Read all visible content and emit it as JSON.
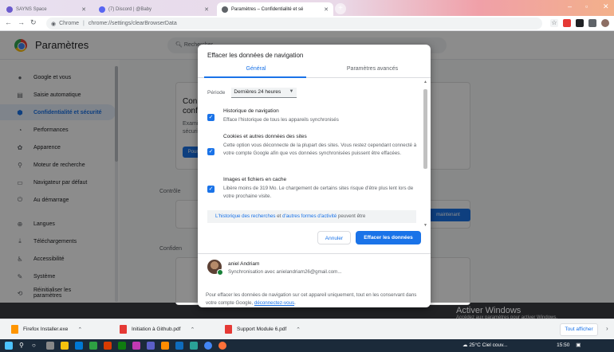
{
  "tabs": [
    {
      "label": "SAYNS Space"
    },
    {
      "label": "(7) Discord | @Baby"
    },
    {
      "label": "Paramètres – Confidentialité et sé"
    }
  ],
  "address": {
    "site": "Chrome",
    "url": "chrome://settings/clearBrowserData"
  },
  "settings": {
    "title": "Paramètres",
    "search_placeholder": "Rechercher",
    "nav": [
      {
        "label": "Google et vous",
        "icon": "person-icon"
      },
      {
        "label": "Saisie automatique",
        "icon": "clipboard-icon"
      },
      {
        "label": "Confidentialité et sécurité",
        "icon": "shield-icon"
      },
      {
        "label": "Performances",
        "icon": "speedometer-icon"
      },
      {
        "label": "Apparence",
        "icon": "palette-icon"
      },
      {
        "label": "Moteur de recherche",
        "icon": "search-icon"
      },
      {
        "label": "Navigateur par défaut",
        "icon": "browser-icon"
      },
      {
        "label": "Au démarrage",
        "icon": "power-icon"
      },
      {
        "label": "Langues",
        "icon": "globe-icon"
      },
      {
        "label": "Téléchargements",
        "icon": "download-icon"
      },
      {
        "label": "Accessibilité",
        "icon": "accessibility-icon"
      },
      {
        "label": "Système",
        "icon": "wrench-icon"
      },
      {
        "label": "Réinitialiser les paramètres",
        "icon": "reset-icon"
      }
    ],
    "bg": {
      "heading_line1": "Con",
      "heading_line2": "conf",
      "sub1": "Examin",
      "sub2": "sécurit",
      "button": "Pour",
      "section1": "Contrôle",
      "section2": "Confiden",
      "right_button": "maintenant"
    }
  },
  "dialog": {
    "title": "Effacer les données de navigation",
    "tab_basic": "Général",
    "tab_advanced": "Paramètres avancés",
    "period_label": "Période",
    "period_value": "Dernières 24 heures",
    "options": [
      {
        "title": "Historique de navigation",
        "desc": "Efface l'historique de tous les appareils synchronisés",
        "checked": true
      },
      {
        "title": "Cookies et autres données des sites",
        "desc": "Cette option vous déconnecte de la plupart des sites. Vous restez cependant connecté à votre compte Google afin que vos données synchronisées puissent être effacées.",
        "checked": true
      },
      {
        "title": "Images et fichiers en cache",
        "desc": "Libère moins de 319 Mo. Le chargement de certains sites risque d'être plus lent lors de votre prochaine visite.",
        "checked": true
      }
    ],
    "info_link1": "L'historique des recherches",
    "info_mid": " et ",
    "info_link2": "d'autres formes d'activité",
    "info_rest": " peuvent être",
    "cancel": "Annuler",
    "confirm": "Effacer les données",
    "account_name": "aniel Andriam",
    "account_sync": "Synchronisation avec anielandriam26@gmail.com...",
    "footnote": "Pour effacer les données de navigation sur cet appareil uniquement, tout en les conservant dans votre compte Google, ",
    "footnote_link": "déconnectez-vous",
    "footnote_end": "."
  },
  "downloads": [
    {
      "name": "Firefox Installer.exe",
      "color": "#ff9500"
    },
    {
      "name": "Initiation à Github.pdf",
      "color": "#e53935"
    },
    {
      "name": "Support Module 6.pdf",
      "color": "#e53935"
    }
  ],
  "show_all": "Tout afficher",
  "watermark": {
    "line1": "Activer Windows",
    "line2": "Accédez aux paramètres pour activer Windows."
  },
  "tray": {
    "weather": "25°C  Ciel couv...",
    "time": "15:50"
  },
  "colors": {
    "accent": "#1a73e8",
    "active_nav_bg": "#e8f0fe"
  }
}
